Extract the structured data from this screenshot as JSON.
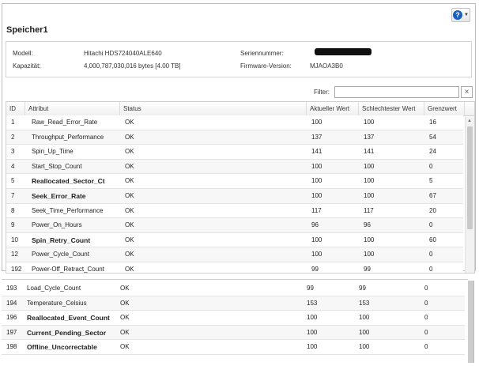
{
  "help": {
    "icon": "question-icon",
    "label": "?"
  },
  "title": "Speicher1",
  "info": {
    "model_label": "Modell:",
    "model_value": "Hitachi HDS724040ALE640",
    "capacity_label": "Kapazität:",
    "capacity_value": "4,000,787,030,016 bytes [4.00 TB]",
    "serial_label": "Seriennummer:",
    "firmware_label": "Firmware-Version:",
    "firmware_value": "MJAOA3B0"
  },
  "filter": {
    "label": "Filter:",
    "value": "",
    "clear": "×"
  },
  "columns": [
    "ID",
    "Attribut",
    "Status",
    "Aktueller Wert",
    "Schlechtester Wert",
    "Grenzwert"
  ],
  "rows": [
    {
      "id": "1",
      "attr": "Raw_Read_Error_Rate",
      "status": "OK",
      "current": "100",
      "worst": "100",
      "threshold": "16",
      "bold": false
    },
    {
      "id": "2",
      "attr": "Throughput_Performance",
      "status": "OK",
      "current": "137",
      "worst": "137",
      "threshold": "54",
      "bold": false
    },
    {
      "id": "3",
      "attr": "Spin_Up_Time",
      "status": "OK",
      "current": "141",
      "worst": "141",
      "threshold": "24",
      "bold": false
    },
    {
      "id": "4",
      "attr": "Start_Stop_Count",
      "status": "OK",
      "current": "100",
      "worst": "100",
      "threshold": "0",
      "bold": false
    },
    {
      "id": "5",
      "attr": "Reallocated_Sector_Ct",
      "status": "OK",
      "current": "100",
      "worst": "100",
      "threshold": "5",
      "bold": true
    },
    {
      "id": "7",
      "attr": "Seek_Error_Rate",
      "status": "OK",
      "current": "100",
      "worst": "100",
      "threshold": "67",
      "bold": true
    },
    {
      "id": "8",
      "attr": "Seek_Time_Performance",
      "status": "OK",
      "current": "117",
      "worst": "117",
      "threshold": "20",
      "bold": false
    },
    {
      "id": "9",
      "attr": "Power_On_Hours",
      "status": "OK",
      "current": "96",
      "worst": "96",
      "threshold": "0",
      "bold": false
    },
    {
      "id": "10",
      "attr": "Spin_Retry_Count",
      "status": "OK",
      "current": "100",
      "worst": "100",
      "threshold": "60",
      "bold": true
    },
    {
      "id": "12",
      "attr": "Power_Cycle_Count",
      "status": "OK",
      "current": "100",
      "worst": "100",
      "threshold": "0",
      "bold": false
    },
    {
      "id": "192",
      "attr": "Power-Off_Retract_Count",
      "status": "OK",
      "current": "99",
      "worst": "99",
      "threshold": "0",
      "bold": false
    }
  ],
  "lower_rows": [
    {
      "id": "193",
      "attr": "Load_Cycle_Count",
      "status": "OK",
      "current": "99",
      "worst": "99",
      "threshold": "0",
      "bold": false
    },
    {
      "id": "194",
      "attr": "Temperature_Celsius",
      "status": "OK",
      "current": "153",
      "worst": "153",
      "threshold": "0",
      "bold": false
    },
    {
      "id": "196",
      "attr": "Reallocated_Event_Count",
      "status": "OK",
      "current": "100",
      "worst": "100",
      "threshold": "0",
      "bold": true
    },
    {
      "id": "197",
      "attr": "Current_Pending_Sector",
      "status": "OK",
      "current": "100",
      "worst": "100",
      "threshold": "0",
      "bold": true
    },
    {
      "id": "198",
      "attr": "Offline_Uncorrectable",
      "status": "OK",
      "current": "100",
      "worst": "100",
      "threshold": "0",
      "bold": true
    }
  ]
}
